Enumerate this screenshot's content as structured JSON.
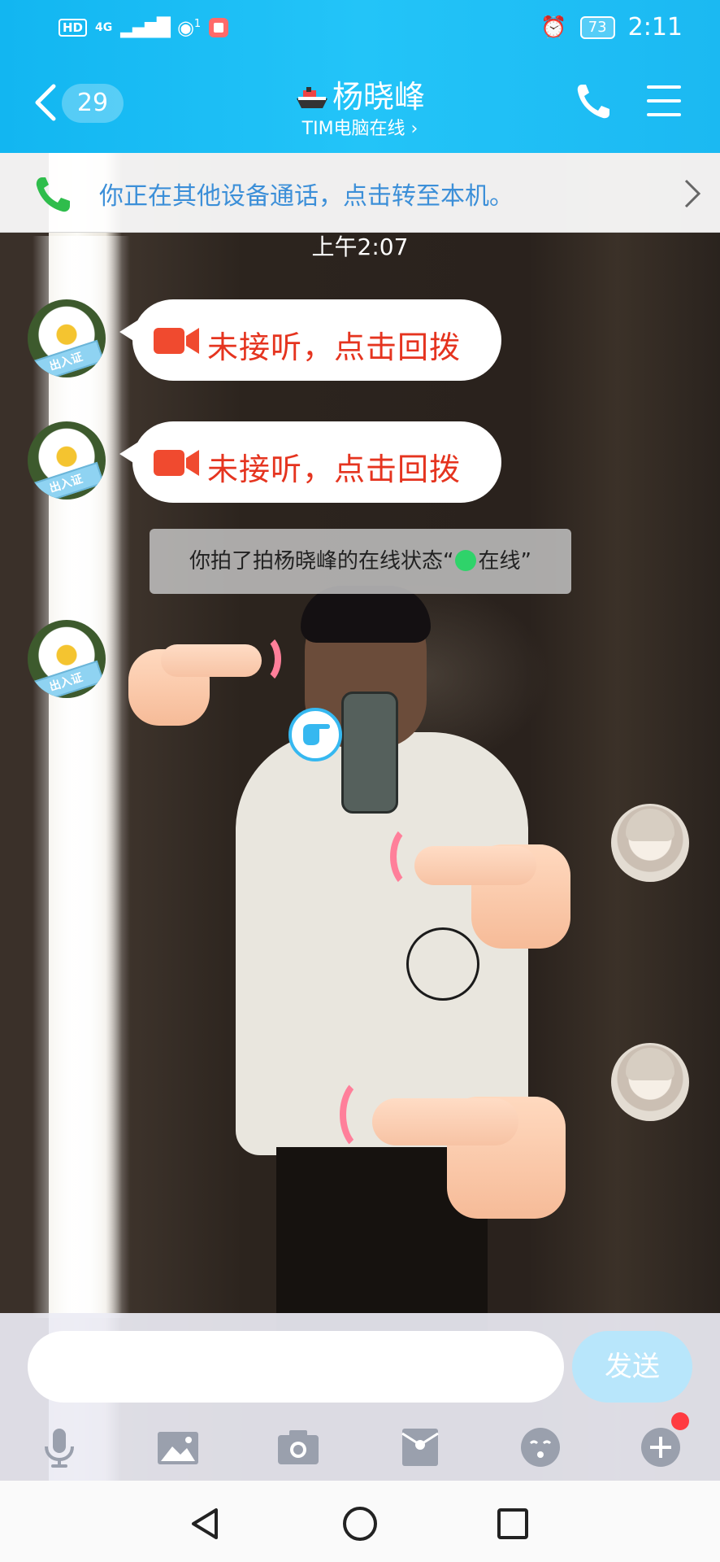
{
  "status_bar": {
    "hd": "HD",
    "network": "4G",
    "hotspot_count": "1",
    "battery": "73",
    "time": "2:11"
  },
  "header": {
    "unread_count": "29",
    "contact_name": "杨晓峰",
    "contact_status": "TIM电脑在线 ›"
  },
  "call_banner": {
    "text": "你正在其他设备通话，点击转至本机。"
  },
  "chat": {
    "timestamp": "上午2:07",
    "missed_call_1": "未接听，点击回拨",
    "missed_call_2": "未接听，点击回拨",
    "system_message_prefix": "你拍了拍杨晓峰的在线状态“",
    "system_message_status": "在线",
    "system_message_suffix": "”",
    "avatar_tag": "出入证"
  },
  "input": {
    "placeholder": "",
    "send_label": "发送"
  },
  "toolbar": {
    "items": [
      "mic-icon",
      "image-icon",
      "camera-icon",
      "red-packet-icon",
      "emoji-icon",
      "plus-icon"
    ]
  },
  "navbar": {
    "items": [
      "back-triangle-icon",
      "home-circle-icon",
      "recents-square-icon"
    ]
  },
  "colors": {
    "header_blue": "#1bb9f2",
    "missed_call_red": "#e5341f",
    "banner_link_blue": "#3c8fd8",
    "online_green": "#2fd36a",
    "send_button": "#b8e6fb"
  }
}
